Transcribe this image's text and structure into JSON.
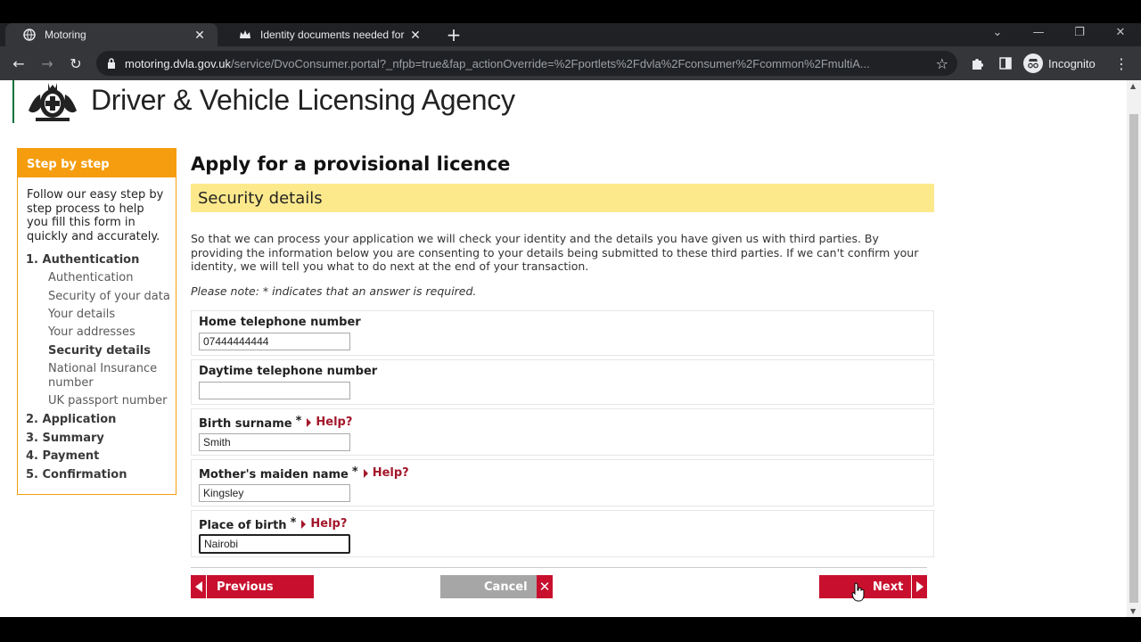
{
  "browser": {
    "tabs": [
      {
        "title": "Motoring",
        "active": true
      },
      {
        "title": "Identity documents needed for a",
        "active": false
      }
    ],
    "url_host": "motoring.dvla.gov.uk",
    "url_path": "/service/DvoConsumer.portal?_nfpb=true&fap_actionOverride=%2Fportlets%2Fdvla%2Fconsumer%2Fcommon%2FmultiA...",
    "profile_label": "Incognito"
  },
  "header": {
    "agency_name": "Driver & Vehicle Licensing Agency"
  },
  "sidebar": {
    "heading": "Step by step",
    "intro": "Follow our easy step by step process to help you fill this form in quickly and accurately.",
    "steps": [
      {
        "label": "1. Authentication"
      },
      {
        "label": "2. Application"
      },
      {
        "label": "3. Summary"
      },
      {
        "label": "4. Payment"
      },
      {
        "label": "5. Confirmation"
      }
    ],
    "substeps": [
      {
        "label": "Authentication"
      },
      {
        "label": "Security of your data"
      },
      {
        "label": "Your details"
      },
      {
        "label": "Your addresses"
      },
      {
        "label": "Security details",
        "current": true
      },
      {
        "label": "National Insurance number"
      },
      {
        "label": "UK passport number"
      }
    ]
  },
  "main": {
    "title": "Apply for a provisional licence",
    "section": "Security details",
    "intro": "So that we can process your application we will check your identity and the details you have given us with third parties. By providing the information below you are consenting to your details being submitted to these third parties. If we can't confirm your identity, we will tell you what to do next at the end of your transaction.",
    "note": "Please note: * indicates that an answer is required.",
    "required_marker": "*",
    "help_label": "Help?",
    "fields": [
      {
        "label": "Home telephone number",
        "value": "07444444444",
        "required": false
      },
      {
        "label": "Daytime telephone number",
        "value": "",
        "required": false
      },
      {
        "label": "Birth surname",
        "value": "Smith",
        "required": true
      },
      {
        "label": "Mother's maiden name",
        "value": "Kingsley",
        "required": true
      },
      {
        "label": "Place of birth",
        "value": "Nairobi",
        "required": true
      }
    ]
  },
  "buttons": {
    "previous": "Previous",
    "cancel": "Cancel",
    "next": "Next"
  }
}
